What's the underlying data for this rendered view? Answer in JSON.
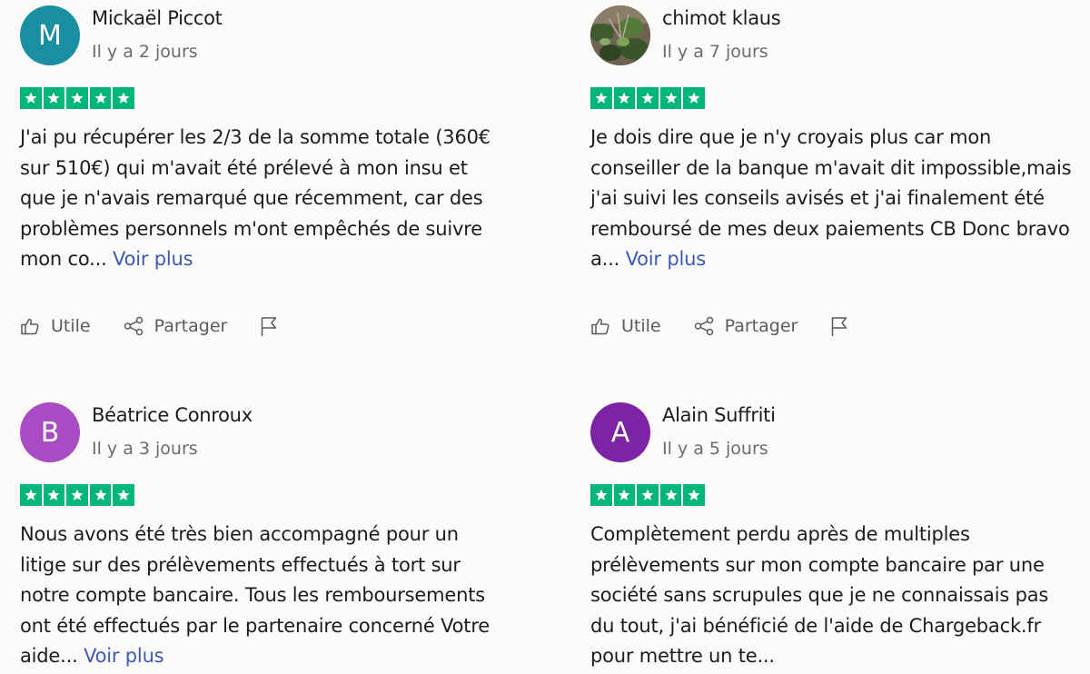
{
  "icons": {
    "star": "star-icon",
    "useful": "thumbs-up-icon",
    "share": "share-icon",
    "report": "flag-icon"
  },
  "colors": {
    "star_bg": "#00b67a",
    "link": "#3b5ab5"
  },
  "reviews": [
    {
      "author": "Mickaël Piccot",
      "avatar_letter": "M",
      "avatar_color": "#1a8fa3",
      "date": "Il y a 2 jours",
      "rating": 5,
      "text": "J'ai pu récupérer les 2/3 de la somme totale (360€ sur 510€) qui m'avait été prélevé à mon insu et que je n'avais remarqué que récemment, car des problèmes personnels m'ont empêchés de suivre mon co...",
      "more_label": "Voir plus",
      "useful_label": "Utile",
      "share_label": "Partager"
    },
    {
      "author": "chimot klaus",
      "avatar_letter": "",
      "avatar_color": "#4a5a3a",
      "date": "Il y a 7 jours",
      "rating": 5,
      "text": "Je dois dire que je n'y croyais plus car mon conseiller de la banque m'avait dit impossible,mais j'ai suivi les conseils avisés et j'ai finalement été remboursé de mes deux paiements CB Donc bravo a...",
      "more_label": "Voir plus",
      "useful_label": "Utile",
      "share_label": "Partager"
    },
    {
      "author": "Béatrice Conroux",
      "avatar_letter": "B",
      "avatar_color": "#a94bc2",
      "date": "Il y a 3 jours",
      "rating": 5,
      "text": "Nous avons été très bien accompagné pour un litige sur des prélèvements effectués à tort sur notre compte bancaire. Tous les remboursements ont été effectués par le partenaire concerné Votre aide...",
      "more_label": "Voir plus"
    },
    {
      "author": "Alain Suffriti",
      "avatar_letter": "A",
      "avatar_color": "#7e22a6",
      "date": "Il y a 5 jours",
      "rating": 5,
      "text": "Complètement perdu après de multiples prélèvements sur mon compte bancaire par une société sans scrupules que je ne connaissais pas du tout, j'ai bénéficié de l'aide de Chargeback.fr pour mettre un te..."
    }
  ]
}
